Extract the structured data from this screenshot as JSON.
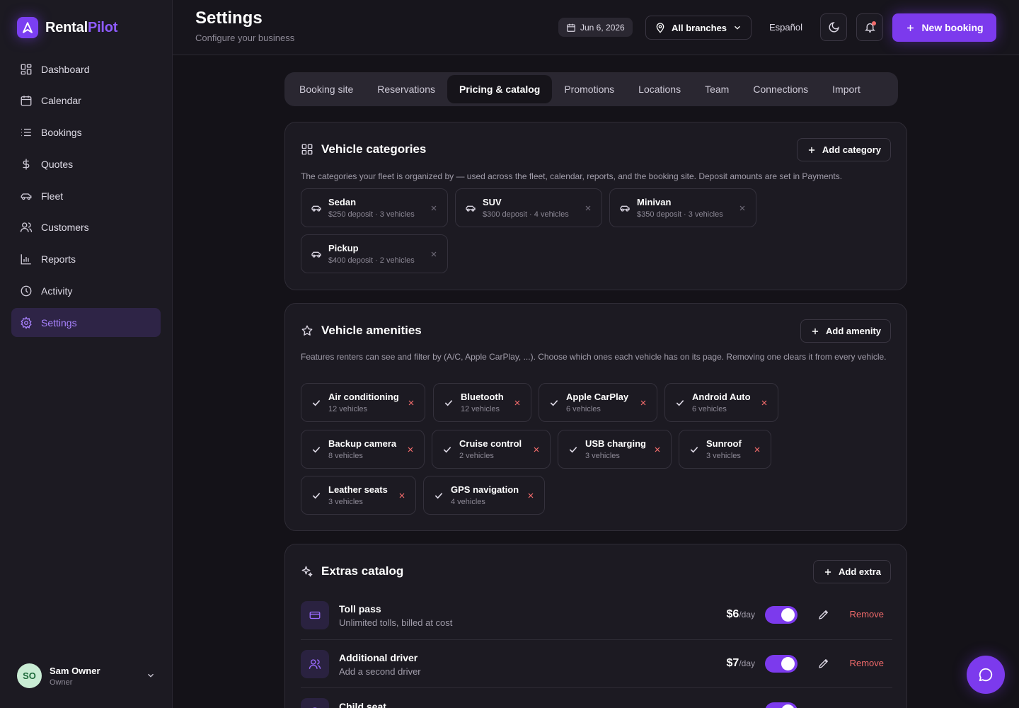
{
  "brand": {
    "name_part1": "Rental",
    "name_part2": "Pilot",
    "accent": "#7c3aed"
  },
  "sidebar": {
    "items": [
      {
        "label": "Dashboard",
        "icon": "grid-icon"
      },
      {
        "label": "Calendar",
        "icon": "calendar-icon"
      },
      {
        "label": "Bookings",
        "icon": "list-icon"
      },
      {
        "label": "Quotes",
        "icon": "dollar-icon"
      },
      {
        "label": "Fleet",
        "icon": "car-icon"
      },
      {
        "label": "Customers",
        "icon": "users-icon"
      },
      {
        "label": "Reports",
        "icon": "bar-chart-icon"
      },
      {
        "label": "Activity",
        "icon": "clock-icon"
      },
      {
        "label": "Settings",
        "icon": "gear-icon",
        "active": true
      }
    ],
    "user": {
      "initials": "SO",
      "name": "Sam Owner",
      "role": "Owner"
    }
  },
  "header": {
    "title": "Settings",
    "subtitle": "Configure your business",
    "date": "Jun 6, 2026",
    "branch": "All branches",
    "language": "Español",
    "new_booking": "New booking"
  },
  "tabs": [
    "Booking site",
    "Reservations",
    "Pricing & catalog",
    "Promotions",
    "Locations",
    "Team",
    "Connections",
    "Import"
  ],
  "active_tab": "Pricing & catalog",
  "categories": {
    "title": "Vehicle categories",
    "add_label": "Add category",
    "description": "The categories your fleet is organized by — used across the fleet, calendar, reports, and the booking site. Deposit amounts are set in Payments.",
    "items": [
      {
        "name": "Sedan",
        "meta": "$250 deposit · 3 vehicles"
      },
      {
        "name": "SUV",
        "meta": "$300 deposit · 4 vehicles"
      },
      {
        "name": "Minivan",
        "meta": "$350 deposit · 3 vehicles"
      },
      {
        "name": "Pickup",
        "meta": "$400 deposit · 2 vehicles"
      }
    ]
  },
  "amenities": {
    "title": "Vehicle amenities",
    "add_label": "Add amenity",
    "description": "Features renters can see and filter by (A/C, Apple CarPlay, ...). Choose which ones each vehicle has on its page. Removing one clears it from every vehicle.",
    "items": [
      {
        "name": "Air conditioning",
        "meta": "12 vehicles"
      },
      {
        "name": "Bluetooth",
        "meta": "12 vehicles"
      },
      {
        "name": "Apple CarPlay",
        "meta": "6 vehicles"
      },
      {
        "name": "Android Auto",
        "meta": "6 vehicles"
      },
      {
        "name": "Backup camera",
        "meta": "8 vehicles"
      },
      {
        "name": "Cruise control",
        "meta": "2 vehicles"
      },
      {
        "name": "USB charging",
        "meta": "3 vehicles"
      },
      {
        "name": "Sunroof",
        "meta": "3 vehicles"
      },
      {
        "name": "Leather seats",
        "meta": "3 vehicles"
      },
      {
        "name": "GPS navigation",
        "meta": "4 vehicles"
      }
    ]
  },
  "extras": {
    "title": "Extras catalog",
    "add_label": "Add extra",
    "remove_label": "Remove",
    "items": [
      {
        "name": "Toll pass",
        "desc": "Unlimited tolls, billed at cost",
        "price": "$6",
        "unit": "/day",
        "enabled": true,
        "icon": "card-icon"
      },
      {
        "name": "Additional driver",
        "desc": "Add a second driver",
        "price": "$7",
        "unit": "/day",
        "enabled": true,
        "icon": "users-icon"
      },
      {
        "name": "Child seat",
        "desc": "",
        "price": "",
        "unit": "",
        "enabled": true,
        "icon": "seat-icon"
      }
    ]
  }
}
